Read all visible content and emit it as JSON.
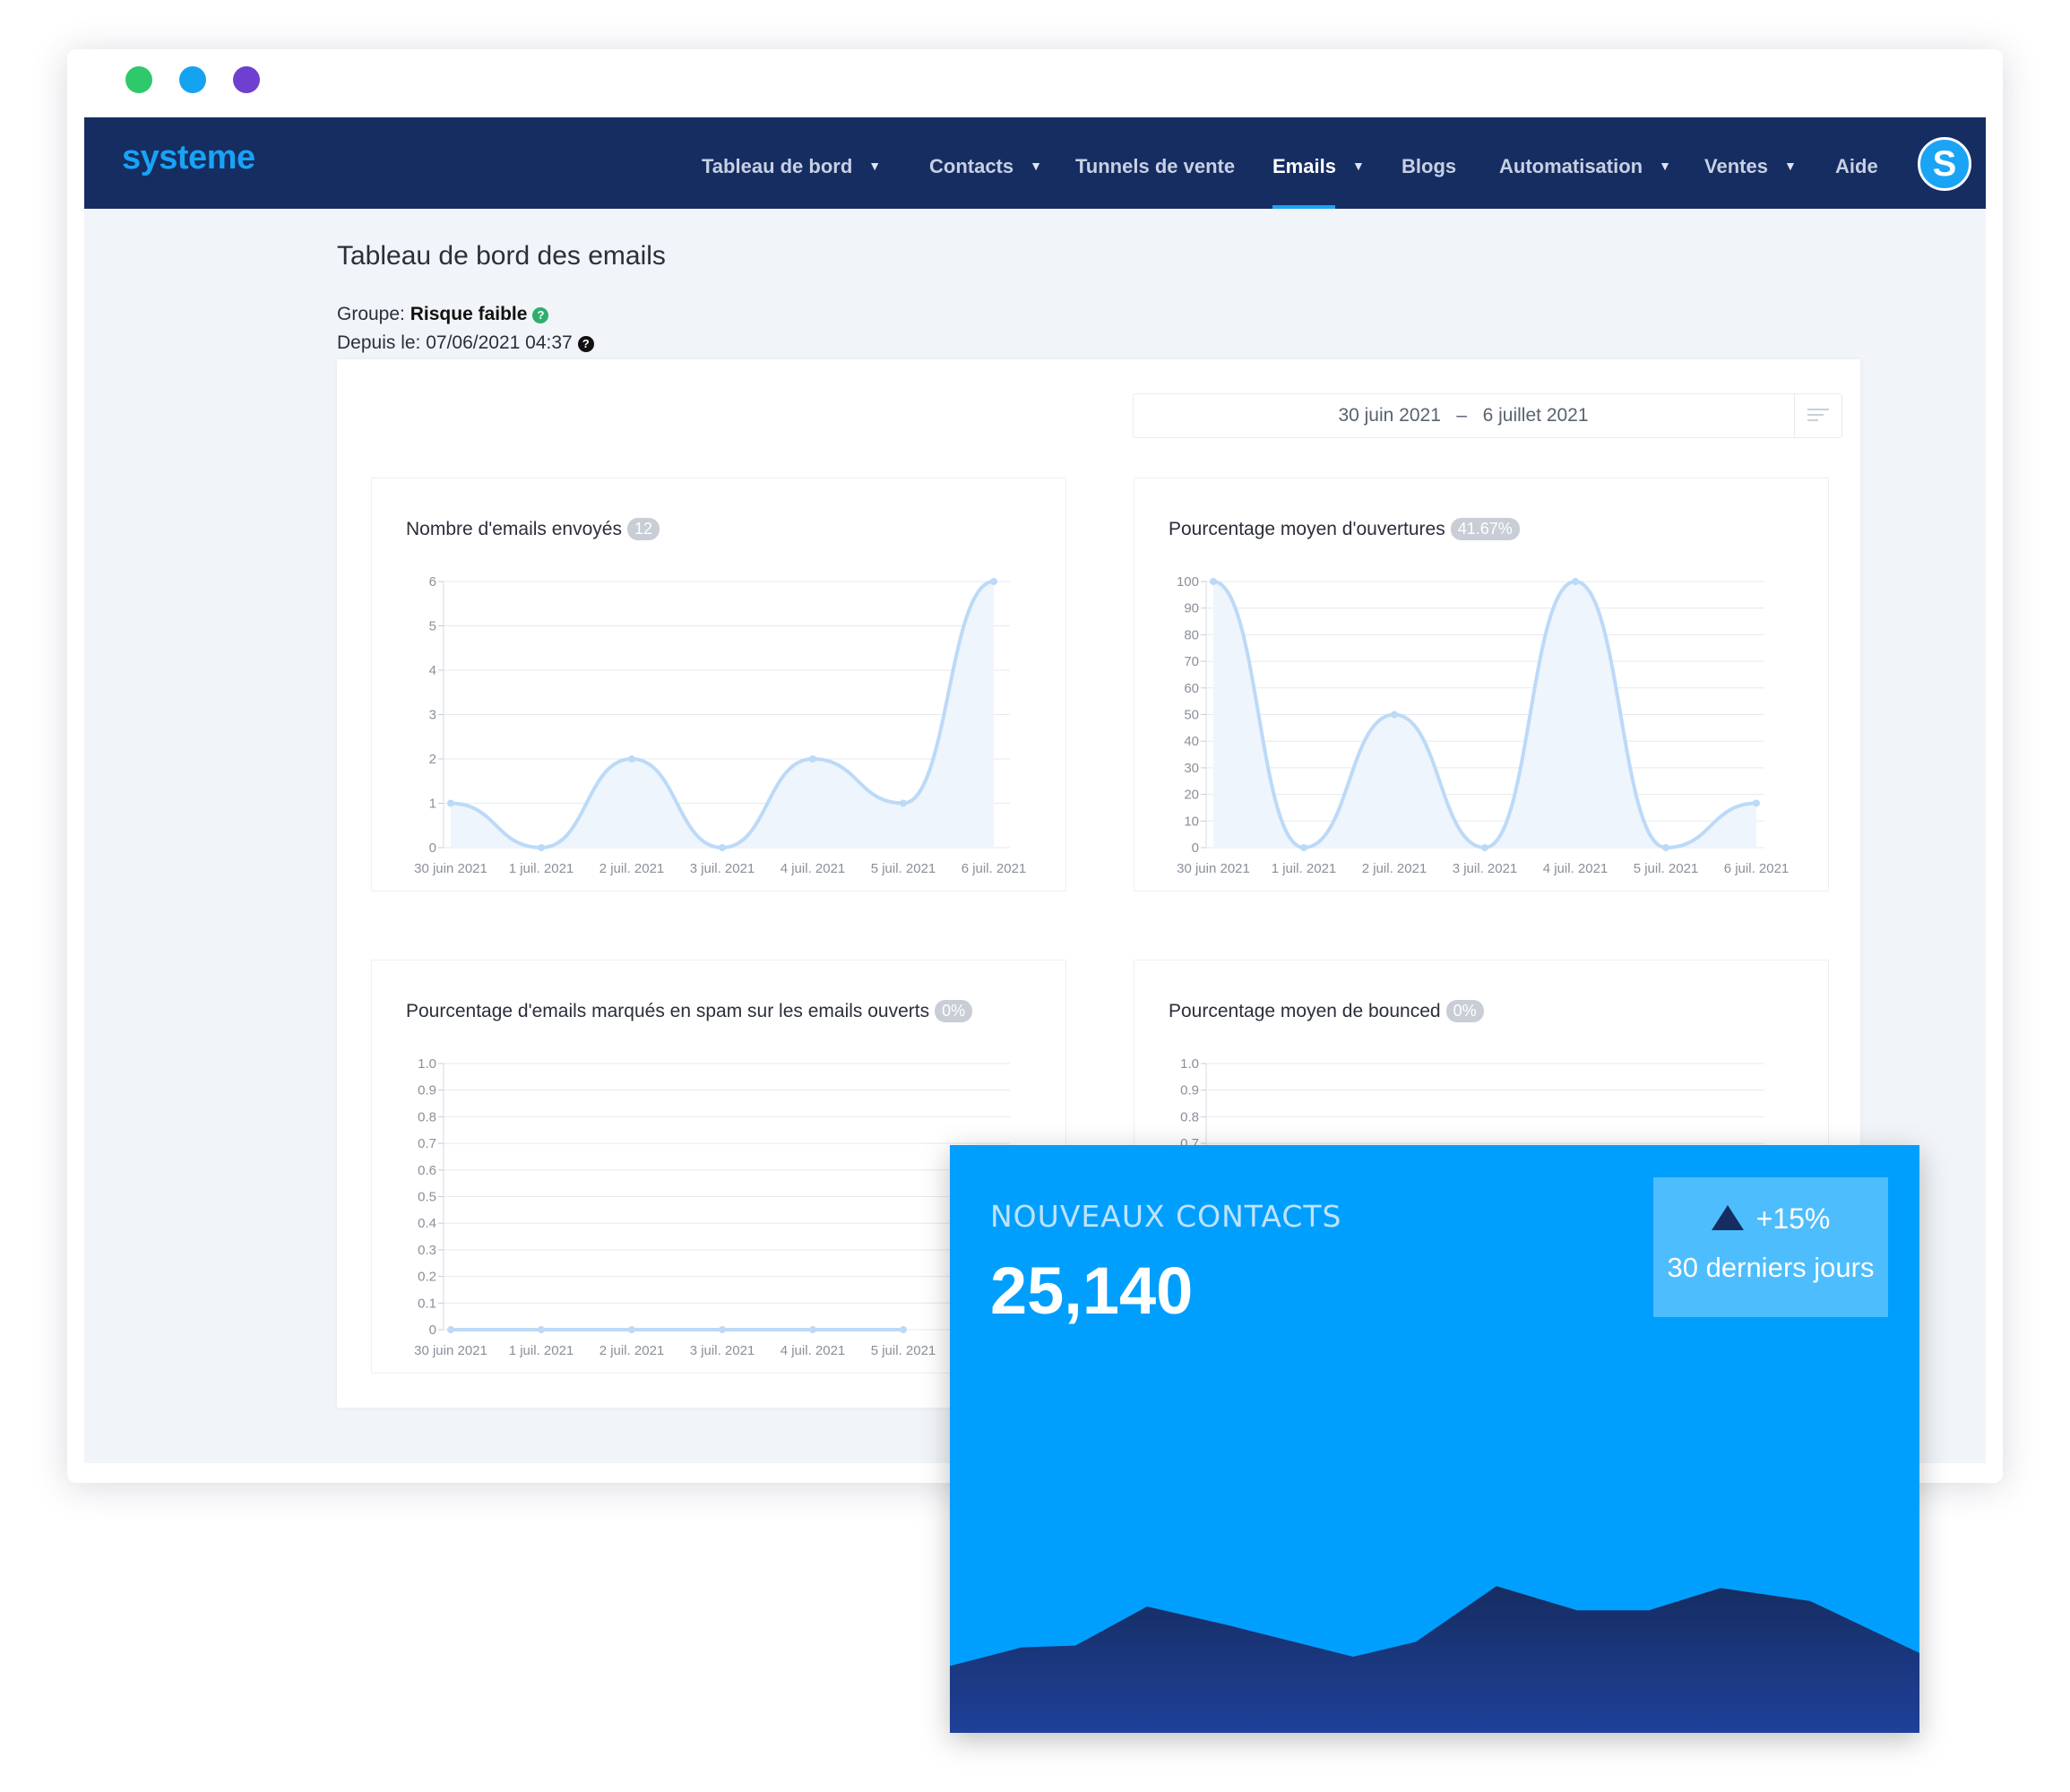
{
  "navbar": {
    "logo": "systeme",
    "items": [
      {
        "label": "Tableau de bord",
        "dropdown": true
      },
      {
        "label": "Contacts",
        "dropdown": true
      },
      {
        "label": "Tunnels de vente",
        "dropdown": false
      },
      {
        "label": "Emails",
        "dropdown": true,
        "active": true
      },
      {
        "label": "Blogs",
        "dropdown": false
      },
      {
        "label": "Automatisation",
        "dropdown": true
      },
      {
        "label": "Ventes",
        "dropdown": true
      },
      {
        "label": "Aide",
        "dropdown": false
      }
    ],
    "avatar_letter": "S"
  },
  "page": {
    "title": "Tableau de bord des emails",
    "group_label": "Groupe:",
    "group_value": "Risque faible",
    "since_label": "Depuis le:",
    "since_value": "07/06/2021 04:37",
    "date_range": {
      "start": "30 juin 2021",
      "separator": "–",
      "end": "6 juillet 2021"
    }
  },
  "cards": [
    {
      "title": "Nombre d'emails envoyés",
      "badge": "12"
    },
    {
      "title": "Pourcentage moyen d'ouvertures",
      "badge": "41.67%"
    },
    {
      "title": "Pourcentage d'emails marqués en spam sur les emails ouverts",
      "badge": "0%"
    },
    {
      "title": "Pourcentage moyen de bounced",
      "badge": "0%"
    }
  ],
  "chart_data": [
    {
      "type": "line",
      "x": [
        "30 juin 2021",
        "1 juil. 2021",
        "2 juil. 2021",
        "3 juil. 2021",
        "4 juil. 2021",
        "5 juil. 2021",
        "6 juil. 2021"
      ],
      "y": [
        1,
        0,
        2,
        0,
        2,
        1,
        6
      ],
      "ylim": [
        0,
        6
      ],
      "yticks": [
        "0",
        "1",
        "2",
        "3",
        "4",
        "5",
        "6"
      ],
      "grid": true
    },
    {
      "type": "line",
      "x": [
        "30 juin 2021",
        "1 juil. 2021",
        "2 juil. 2021",
        "3 juil. 2021",
        "4 juil. 2021",
        "5 juil. 2021",
        "6 juil. 2021"
      ],
      "y": [
        100,
        0,
        50,
        0,
        100,
        0,
        16.67
      ],
      "ylim": [
        0,
        100
      ],
      "yticks": [
        "0",
        "10",
        "20",
        "30",
        "40",
        "50",
        "60",
        "70",
        "80",
        "90",
        "100"
      ],
      "grid": true
    },
    {
      "type": "line",
      "x": [
        "30 juin 2021",
        "1 juil. 2021",
        "2 juil. 2021",
        "3 juil. 2021",
        "4 juil. 2021",
        "5 juil. 2021"
      ],
      "y": [
        0,
        0,
        0,
        0,
        0,
        0
      ],
      "ylim": [
        0,
        1.0
      ],
      "yticks": [
        "0",
        "0.1",
        "0.2",
        "0.3",
        "0.4",
        "0.5",
        "0.6",
        "0.7",
        "0.8",
        "0.9",
        "1.0"
      ],
      "grid": true
    },
    {
      "type": "line",
      "x": [],
      "y": [],
      "ylim": [
        0,
        1.0
      ],
      "yticks": [
        "0.7",
        "0.8",
        "0.9",
        "1.0"
      ],
      "grid": true
    },
    {
      "type": "area",
      "y": [
        0.36,
        0.46,
        0.47,
        0.68,
        0.58,
        0.41,
        0.49,
        0.79,
        0.66,
        0.66,
        0.78,
        0.71,
        0.43
      ]
    }
  ],
  "stat": {
    "label": "NOUVEAUX CONTACTS",
    "value": "25,140",
    "change": "+15%",
    "period": "30 derniers jours"
  },
  "colors": {
    "navbar": "#162d62",
    "accent": "#1aa4f5",
    "stat_bg": "#019ffd",
    "area_fill": "#162d62"
  }
}
